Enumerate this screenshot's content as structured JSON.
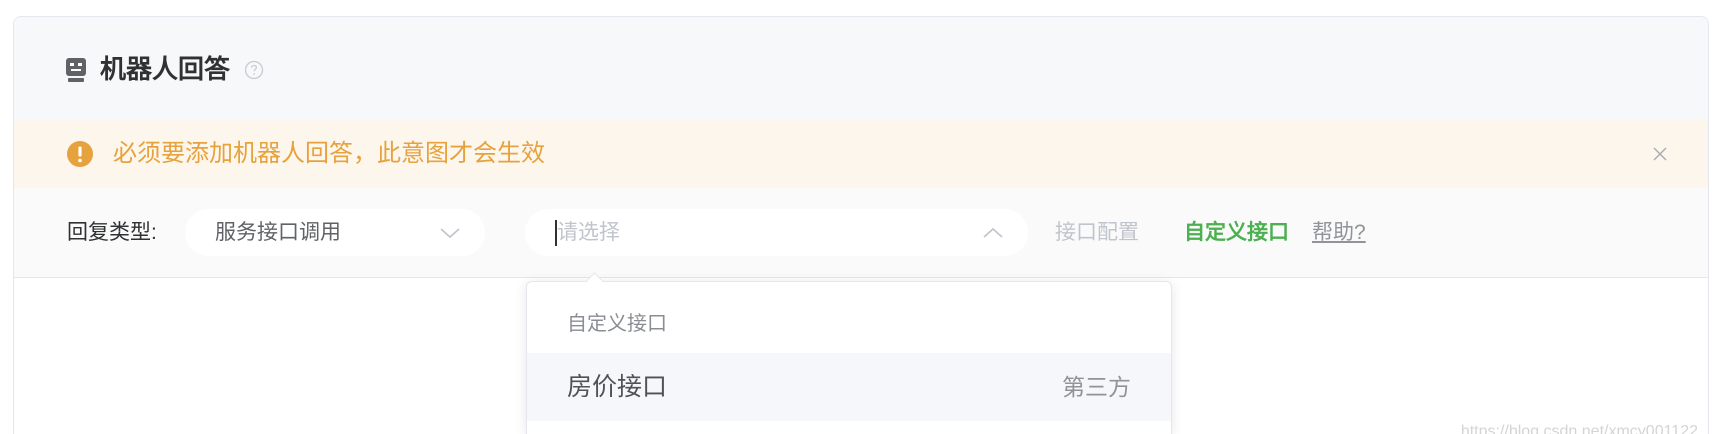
{
  "section": {
    "title": "机器人回答",
    "icon": "robot-icon",
    "help_icon": "question-circle-icon"
  },
  "alert": {
    "message": "必须要添加机器人回答，此意图才会生效",
    "icon": "warning-icon",
    "close_icon": "close-icon",
    "type": "warning"
  },
  "reply": {
    "label": "回复类型:",
    "type_select": {
      "value": "服务接口调用",
      "icon": "chevron-down-icon"
    },
    "interface_select": {
      "placeholder": "请选择",
      "icon": "chevron-up-icon",
      "expanded": true
    },
    "config_link": "接口配置",
    "custom_link": "自定义接口",
    "help_link": "帮助?"
  },
  "dropdown": {
    "group_title": "自定义接口",
    "options": [
      {
        "label": "房价接口",
        "tag": "第三方",
        "hovered": true
      }
    ]
  },
  "watermark": "https://blog.csdn.net/xmcy001122",
  "colors": {
    "header_bg": "#f7f8fa",
    "alert_bg": "#fdf6ec",
    "warning": "#e6a23c",
    "row_bg": "#fafafa",
    "link_green": "#4caf50",
    "muted": "#c0c4cc",
    "option_hover_bg": "#f5f7fa"
  }
}
